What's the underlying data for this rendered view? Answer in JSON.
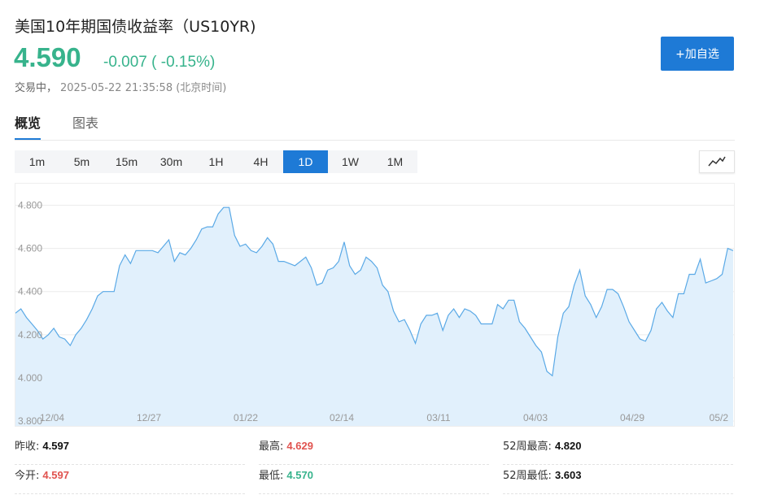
{
  "header": {
    "title": "美国10年期国债收益率（US10YR)",
    "price": "4.590",
    "change": "-0.007 ( -0.15%)",
    "status": "交易中，",
    "timestamp": "2025-05-22 21:35:58 (北京时间)",
    "add_button": "+加自选"
  },
  "tabs": [
    {
      "label": "概览",
      "active": true
    },
    {
      "label": "图表",
      "active": false
    }
  ],
  "periods": [
    "1m",
    "5m",
    "15m",
    "30m",
    "1H",
    "4H",
    "1D",
    "1W",
    "1M"
  ],
  "active_period": "1D",
  "chart_toggle_icon": "line-chart-icon",
  "colors": {
    "accent": "#1e7ad6",
    "down": "#37b38c",
    "up": "#e0534f",
    "line": "#5aa9e6",
    "fill": "#e1f0fc"
  },
  "chart_data": {
    "type": "area",
    "ylim": [
      3.8,
      4.9
    ],
    "yticks": [
      "3.800",
      "4.000",
      "4.200",
      "4.400",
      "4.600",
      "4.800"
    ],
    "xtick_labels": [
      "12/04",
      "12/27",
      "01/22",
      "02/14",
      "03/11",
      "04/03",
      "04/29",
      "05/2"
    ],
    "values": [
      4.3,
      4.32,
      4.28,
      4.25,
      4.22,
      4.18,
      4.2,
      4.23,
      4.19,
      4.18,
      4.15,
      4.2,
      4.23,
      4.27,
      4.32,
      4.38,
      4.4,
      4.4,
      4.4,
      4.52,
      4.57,
      4.53,
      4.59,
      4.59,
      4.59,
      4.59,
      4.58,
      4.61,
      4.64,
      4.54,
      4.58,
      4.57,
      4.6,
      4.64,
      4.69,
      4.7,
      4.7,
      4.76,
      4.79,
      4.79,
      4.66,
      4.61,
      4.62,
      4.59,
      4.58,
      4.61,
      4.65,
      4.62,
      4.54,
      4.54,
      4.53,
      4.52,
      4.54,
      4.56,
      4.51,
      4.43,
      4.44,
      4.5,
      4.51,
      4.54,
      4.63,
      4.52,
      4.48,
      4.5,
      4.56,
      4.54,
      4.51,
      4.43,
      4.4,
      4.31,
      4.26,
      4.27,
      4.22,
      4.16,
      4.25,
      4.29,
      4.29,
      4.3,
      4.22,
      4.29,
      4.32,
      4.28,
      4.32,
      4.31,
      4.29,
      4.25,
      4.25,
      4.25,
      4.34,
      4.32,
      4.36,
      4.36,
      4.26,
      4.23,
      4.19,
      4.15,
      4.12,
      4.03,
      4.01,
      4.19,
      4.3,
      4.33,
      4.43,
      4.5,
      4.38,
      4.34,
      4.28,
      4.33,
      4.41,
      4.41,
      4.39,
      4.33,
      4.26,
      4.22,
      4.18,
      4.17,
      4.22,
      4.32,
      4.35,
      4.31,
      4.28,
      4.39,
      4.39,
      4.48,
      4.48,
      4.55,
      4.44,
      4.45,
      4.46,
      4.48,
      4.6,
      4.59
    ]
  },
  "stats": [
    [
      {
        "label": "昨收:",
        "value": "4.597",
        "color": "dark"
      },
      {
        "label": "今开:",
        "value": "4.597",
        "color": "red"
      }
    ],
    [
      {
        "label": "最高:",
        "value": "4.629",
        "color": "red"
      },
      {
        "label": "最低:",
        "value": "4.570",
        "color": "green"
      }
    ],
    [
      {
        "label": "52周最高:",
        "value": "4.820",
        "color": "dark"
      },
      {
        "label": "52周最低:",
        "value": "3.603",
        "color": "dark"
      }
    ]
  ]
}
